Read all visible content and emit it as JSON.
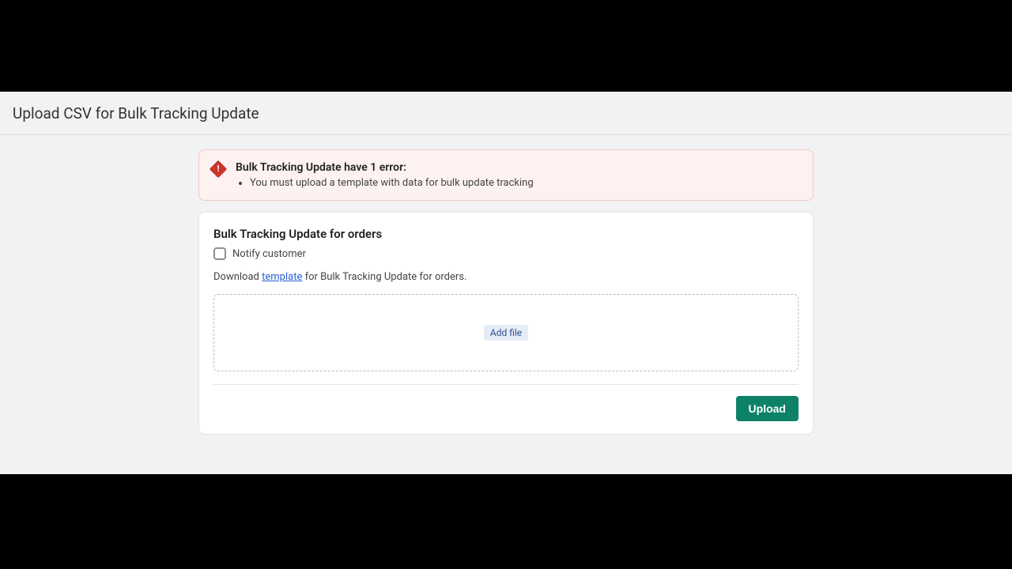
{
  "header": {
    "title": "Upload CSV for Bulk Tracking Update"
  },
  "error": {
    "title": "Bulk Tracking Update have 1 error:",
    "items": [
      "You must upload a template with data for bulk update tracking"
    ]
  },
  "card": {
    "title": "Bulk Tracking Update for orders",
    "notify_label": "Notify customer",
    "download_prefix": "Download ",
    "template_link": "template",
    "download_suffix": " for Bulk Tracking Update for orders.",
    "add_file_label": "Add file",
    "upload_label": "Upload"
  }
}
